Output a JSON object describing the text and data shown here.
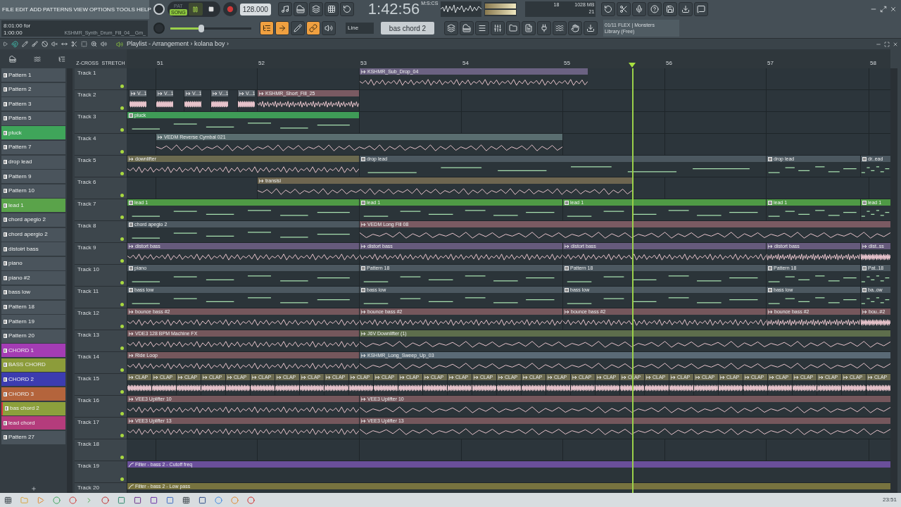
{
  "menu": [
    "FILE",
    "EDIT",
    "ADD",
    "PATTERNS",
    "VIEW",
    "OPTIONS",
    "TOOLS",
    "HELP"
  ],
  "hint": {
    "line_1": "8:01:00 for",
    "line_2": "1:00:00",
    "file": "KSHMR_Synth_Drum_Fill_04__Gm_"
  },
  "transport": {
    "modes": [
      {
        "label": "PAT",
        "selected": false
      },
      {
        "label": "SONG",
        "selected": true
      }
    ],
    "playing": true,
    "recording": false,
    "tempo": "128.000",
    "time": "1:42:56",
    "time_format": "M:S:CS"
  },
  "master_pitch": {
    "level": 0.38
  },
  "cpu": {
    "voices": "18",
    "memory": "1028 MB",
    "polyphony": "21"
  },
  "toggles": [
    {
      "on": true
    },
    {
      "on": true
    },
    {
      "on": false
    },
    {
      "on": true
    },
    {
      "on": false
    }
  ],
  "snap": "Line",
  "current_pattern": "bas chord 2",
  "news": {
    "line_1": "01/11  FLEX | Monsters",
    "line_2": "Library (Free)"
  },
  "playlist": {
    "path": "Playlist - Arrangement › kolana boy ›",
    "picker_options": [
      "Z-CROSS",
      "STRETCH"
    ],
    "ruler": [
      "51",
      "52",
      "53",
      "54",
      "55",
      "56",
      "57",
      "58"
    ],
    "patterns": [
      {
        "label": "Pattern 1",
        "color": "#4a545c",
        "selected": false
      },
      {
        "label": "Pattern 2",
        "color": "#4a545c",
        "selected": false
      },
      {
        "label": "Pattern 3",
        "color": "#4a545c",
        "selected": false
      },
      {
        "label": "Pattern 5",
        "color": "#4a545c",
        "selected": false
      },
      {
        "label": "pluck",
        "color": "#3fa55a",
        "selected": false
      },
      {
        "label": "Pattern 7",
        "color": "#4a545c",
        "selected": false
      },
      {
        "label": "drop lead",
        "color": "#4a545c",
        "selected": false
      },
      {
        "label": "Pattern 9",
        "color": "#4a545c",
        "selected": false
      },
      {
        "label": "Pattern 10",
        "color": "#4a545c",
        "selected": false
      },
      {
        "label": "lead 1",
        "color": "#5aa34a",
        "selected": false
      },
      {
        "label": "chord apegio 2",
        "color": "#4a545c",
        "selected": false
      },
      {
        "label": "chord apergio 2",
        "color": "#4a545c",
        "selected": false
      },
      {
        "label": "distoirt bass",
        "color": "#4a545c",
        "selected": false
      },
      {
        "label": "piano",
        "color": "#4a545c",
        "selected": false
      },
      {
        "label": "piano #2",
        "color": "#4a545c",
        "selected": false
      },
      {
        "label": "bass low",
        "color": "#4a545c",
        "selected": false
      },
      {
        "label": "Pattern 18",
        "color": "#4a545c",
        "selected": false
      },
      {
        "label": "Pattern 19",
        "color": "#4a545c",
        "selected": false
      },
      {
        "label": "Pattern 20",
        "color": "#4a545c",
        "selected": false
      },
      {
        "label": "CHORD 1",
        "color": "#a43cb4",
        "selected": false
      },
      {
        "label": "BASS CHORD",
        "color": "#8c9c3a",
        "selected": false
      },
      {
        "label": "CHORD 2",
        "color": "#3c3cb0",
        "selected": false
      },
      {
        "label": "CHORD 3",
        "color": "#b4643c",
        "selected": false
      },
      {
        "label": "bas chord 2",
        "color": "#8ca03c",
        "selected": true
      },
      {
        "label": "lead chord",
        "color": "#b43c7c",
        "selected": false
      },
      {
        "label": "Pattern 27",
        "color": "#4a545c",
        "selected": false
      }
    ],
    "tracks": [
      {
        "name": "Track 1",
        "clips": [
          {
            "label": "KSHMR_Sub_Drop_04",
            "kind": "audio",
            "color": "#6b6282"
          }
        ]
      },
      {
        "name": "Track 2",
        "clips": [
          {
            "label": "V...1",
            "kind": "audio",
            "color": "#5c656c"
          },
          {
            "label": "V...1",
            "kind": "audio",
            "color": "#5c656c"
          },
          {
            "label": "V...1",
            "kind": "audio",
            "color": "#5c656c"
          },
          {
            "label": "V...1",
            "kind": "audio",
            "color": "#5c656c"
          },
          {
            "label": "V...1",
            "kind": "audio",
            "color": "#5c656c"
          },
          {
            "label": "KSHMR_Short_Fill_25",
            "kind": "audio",
            "color": "#7a5a62"
          }
        ]
      },
      {
        "name": "Track 3",
        "clips": [
          {
            "label": "pluck",
            "kind": "pattern",
            "color": "#3f9b57"
          }
        ]
      },
      {
        "name": "Track 4",
        "clips": [
          {
            "label": "VEDM Reverse Cymbal 021",
            "kind": "audio",
            "color": "#5a6e70"
          }
        ]
      },
      {
        "name": "Track 5",
        "clips": [
          {
            "label": "downlifter",
            "kind": "audio",
            "color": "#6b6a4f"
          },
          {
            "label": "drop lead",
            "kind": "pattern",
            "color": "#4c5860"
          },
          {
            "label": "drop lead",
            "kind": "pattern",
            "color": "#4c5860"
          },
          {
            "label": "dr..ead",
            "kind": "pattern",
            "color": "#4c5860"
          }
        ]
      },
      {
        "name": "Track 6",
        "clips": [
          {
            "label": "transisi",
            "kind": "audio",
            "color": "#6e6650"
          }
        ]
      },
      {
        "name": "Track 7",
        "clips": [
          {
            "label": "lead 1",
            "kind": "pattern",
            "color": "#4f9a45"
          },
          {
            "label": "lead 1",
            "kind": "pattern",
            "color": "#4f9a45"
          },
          {
            "label": "lead 1",
            "kind": "pattern",
            "color": "#4f9a45"
          },
          {
            "label": "lead 1",
            "kind": "pattern",
            "color": "#4f9a45"
          },
          {
            "label": "lead 1",
            "kind": "pattern",
            "color": "#4f9a45"
          }
        ]
      },
      {
        "name": "Track 8",
        "clips": [
          {
            "label": "chord apegio 2",
            "kind": "pattern",
            "color": "#4c5860"
          },
          {
            "label": "VEDM Long Fill 08",
            "kind": "audio",
            "color": "#7a5a62"
          }
        ]
      },
      {
        "name": "Track 9",
        "clips": [
          {
            "label": "distort bass",
            "kind": "audio",
            "color": "#665a7c"
          },
          {
            "label": "distort bass",
            "kind": "audio",
            "color": "#665a7c"
          },
          {
            "label": "distort bass",
            "kind": "audio",
            "color": "#665a7c"
          },
          {
            "label": "distort bass",
            "kind": "audio",
            "color": "#665a7c"
          },
          {
            "label": "dist..ss",
            "kind": "audio",
            "color": "#665a7c"
          }
        ]
      },
      {
        "name": "Track 10",
        "clips": [
          {
            "label": "piano",
            "kind": "pattern",
            "color": "#4c5860"
          },
          {
            "label": "Pattern 18",
            "kind": "pattern",
            "color": "#4c5860"
          },
          {
            "label": "Pattern 18",
            "kind": "pattern",
            "color": "#4c5860"
          },
          {
            "label": "Pattern 18",
            "kind": "pattern",
            "color": "#4c5860"
          },
          {
            "label": "Pat..18",
            "kind": "pattern",
            "color": "#4c5860"
          }
        ]
      },
      {
        "name": "Track 11",
        "clips": [
          {
            "label": "bass low",
            "kind": "pattern",
            "color": "#4c5860"
          },
          {
            "label": "bass low",
            "kind": "pattern",
            "color": "#4c5860"
          },
          {
            "label": "bass low",
            "kind": "pattern",
            "color": "#4c5860"
          },
          {
            "label": "bass low",
            "kind": "pattern",
            "color": "#4c5860"
          },
          {
            "label": "ba..ow",
            "kind": "pattern",
            "color": "#4c5860"
          }
        ]
      },
      {
        "name": "Track 12",
        "clips": [
          {
            "label": "bounce bass #2",
            "kind": "audio",
            "color": "#75575c"
          },
          {
            "label": "bounce bass #2",
            "kind": "audio",
            "color": "#75575c"
          },
          {
            "label": "bounce bass #2",
            "kind": "audio",
            "color": "#75575c"
          },
          {
            "label": "bounce bass #2",
            "kind": "audio",
            "color": "#75575c"
          },
          {
            "label": "bou..#2",
            "kind": "audio",
            "color": "#75575c"
          }
        ]
      },
      {
        "name": "Track 13",
        "clips": [
          {
            "label": "VDE3 128 BPM Machine FX",
            "kind": "audio",
            "color": "#75575c"
          },
          {
            "label": "J6V Downlifter (1)",
            "kind": "audio",
            "color": "#5e6e4c"
          }
        ]
      },
      {
        "name": "Track 14",
        "clips": [
          {
            "label": "Ride Loop",
            "kind": "audio",
            "color": "#75575c"
          },
          {
            "label": "KSHMR_Long_Sweep_Up_03",
            "kind": "audio",
            "color": "#5a6a76"
          }
        ]
      },
      {
        "name": "Track 15",
        "clips": [
          {
            "label": "CLAP",
            "kind": "audio",
            "color": "#6b6a4f"
          },
          {
            "label": "CLAP",
            "kind": "audio",
            "color": "#6b6a4f"
          },
          {
            "label": "CLAP",
            "kind": "audio",
            "color": "#6b6a4f"
          },
          {
            "label": "CLAP",
            "kind": "audio",
            "color": "#6b6a4f"
          },
          {
            "label": "CLAP",
            "kind": "audio",
            "color": "#6b6a4f"
          },
          {
            "label": "CLAP",
            "kind": "audio",
            "color": "#6b6a4f"
          },
          {
            "label": "CLAP",
            "kind": "audio",
            "color": "#6b6a4f"
          },
          {
            "label": "CLAP",
            "kind": "audio",
            "color": "#6b6a4f"
          },
          {
            "label": "CLAP",
            "kind": "audio",
            "color": "#6b6a4f"
          },
          {
            "label": "CLAP",
            "kind": "audio",
            "color": "#6b6a4f"
          },
          {
            "label": "CLAP",
            "kind": "audio",
            "color": "#6b6a4f"
          },
          {
            "label": "CLAP",
            "kind": "audio",
            "color": "#6b6a4f"
          },
          {
            "label": "CLAP",
            "kind": "audio",
            "color": "#6b6a4f"
          },
          {
            "label": "CLAP",
            "kind": "audio",
            "color": "#6b6a4f"
          },
          {
            "label": "CLAP",
            "kind": "audio",
            "color": "#6b6a4f"
          },
          {
            "label": "CLAP",
            "kind": "audio",
            "color": "#6b6a4f"
          },
          {
            "label": "CLAP",
            "kind": "audio",
            "color": "#6b6a4f"
          },
          {
            "label": "CLAP",
            "kind": "audio",
            "color": "#6b6a4f"
          },
          {
            "label": "CLAP",
            "kind": "audio",
            "color": "#6b6a4f"
          },
          {
            "label": "CLAP",
            "kind": "audio",
            "color": "#6b6a4f"
          },
          {
            "label": "CLAP",
            "kind": "audio",
            "color": "#6b6a4f"
          },
          {
            "label": "CLAP",
            "kind": "audio",
            "color": "#6b6a4f"
          },
          {
            "label": "CLAP",
            "kind": "audio",
            "color": "#6b6a4f"
          },
          {
            "label": "CLAP",
            "kind": "audio",
            "color": "#6b6a4f"
          },
          {
            "label": "CLAP",
            "kind": "audio",
            "color": "#6b6a4f"
          },
          {
            "label": "CLAP",
            "kind": "audio",
            "color": "#6b6a4f"
          },
          {
            "label": "CLAP",
            "kind": "audio",
            "color": "#6b6a4f"
          },
          {
            "label": "CLAP",
            "kind": "audio",
            "color": "#6b6a4f"
          },
          {
            "label": "CLAP",
            "kind": "audio",
            "color": "#6b6a4f"
          },
          {
            "label": "CLAP",
            "kind": "audio",
            "color": "#6b6a4f"
          },
          {
            "label": "CLAP",
            "kind": "audio",
            "color": "#6b6a4f"
          }
        ]
      },
      {
        "name": "Track 16",
        "clips": [
          {
            "label": "VEE3 Uplifter 10",
            "kind": "audio",
            "color": "#75575c"
          },
          {
            "label": "VEE3 Uplifter 10",
            "kind": "audio",
            "color": "#75575c"
          }
        ]
      },
      {
        "name": "Track 17",
        "clips": [
          {
            "label": "VEE3 Uplifter 13",
            "kind": "audio",
            "color": "#75575c"
          },
          {
            "label": "VEE3 Uplifter 13",
            "kind": "audio",
            "color": "#75575c"
          }
        ]
      },
      {
        "name": "Track 18"
      },
      {
        "name": "Track 19",
        "clips": [
          {
            "label": "Filter - bass 2 - Cutoff freq",
            "kind": "automation",
            "color": "#6a4f9a"
          }
        ]
      },
      {
        "name": "Track 20",
        "clips": [
          {
            "label": "Filter - bass 2 - Low pass",
            "kind": "automation",
            "color": "#77733f"
          }
        ]
      }
    ]
  },
  "taskbar": {
    "clock": "23:51"
  }
}
